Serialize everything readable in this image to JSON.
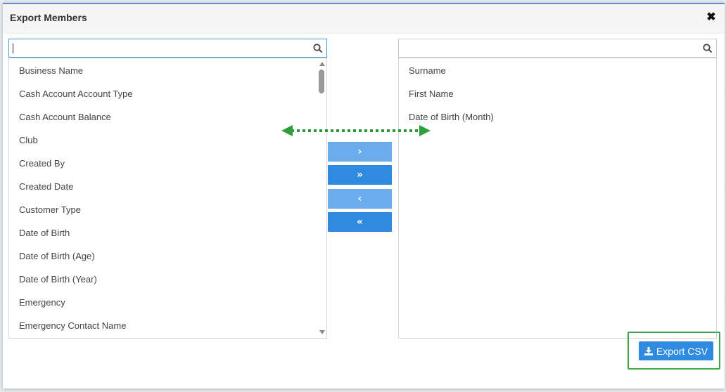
{
  "modal": {
    "title": "Export Members",
    "close_symbol": "✖"
  },
  "left_panel": {
    "search": {
      "value": "",
      "placeholder": "",
      "icon": "search-icon"
    },
    "items": [
      "Business Name",
      "Cash Account Account Type",
      "Cash Account Balance",
      "Club",
      "Created By",
      "Created Date",
      "Customer Type",
      "Date of Birth",
      "Date of Birth (Age)",
      "Date of Birth (Year)",
      "Emergency",
      "Emergency Contact Name"
    ]
  },
  "right_panel": {
    "search": {
      "value": "",
      "placeholder": "",
      "icon": "search-icon"
    },
    "items": [
      "Surname",
      "First Name",
      "Date of Birth (Month)"
    ]
  },
  "transfer_buttons": {
    "move_selected_right": "›",
    "move_all_right": "»",
    "move_selected_left": "‹",
    "move_all_left": "«"
  },
  "export_button": {
    "label": "Export CSV",
    "icon": "download-icon"
  },
  "colors": {
    "primary": "#2f8ae0",
    "primary_light": "#6aacec",
    "annotation_green": "#2e9e3a"
  }
}
